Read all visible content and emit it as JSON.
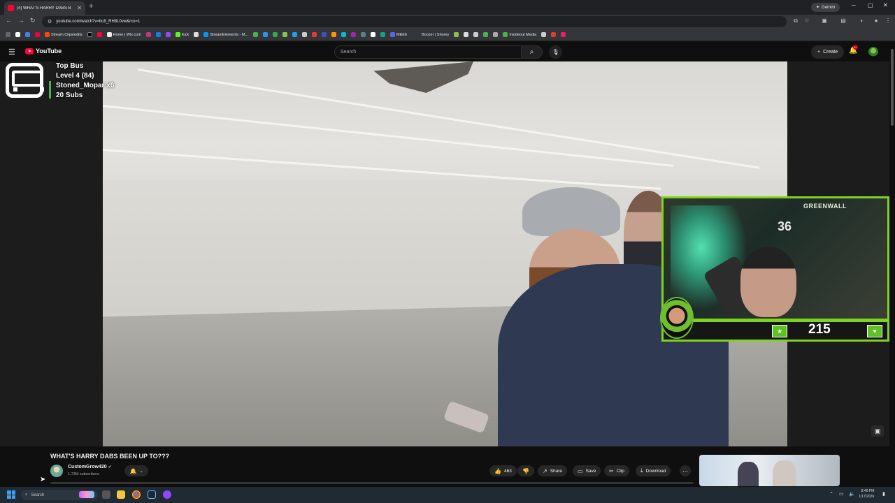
{
  "browser": {
    "tab_title": "(4) WHAT'S HARRY DABS B",
    "new_tab": "+",
    "gemini": "Gemini",
    "url": "youtube.com/watch?v=bu9_RH8L0vw&rco=1",
    "bookmarks": [
      "Stream Clips/edits",
      "Home | Wix.com",
      "Kick",
      "StreamElements - M...",
      "MEE6",
      "Boozer | Shorey",
      "Insideout Media"
    ]
  },
  "youtube": {
    "logo": "YouTube",
    "search_placeholder": "Search",
    "create": "Create",
    "notif_count": "9+"
  },
  "overlay": {
    "line1": "Top Bus",
    "line2": "Level 4  (84)",
    "line3": "Stoned_Mopar x6",
    "line4": "20 Subs"
  },
  "webcam": {
    "sign": "GREENWALL",
    "jersey": "36",
    "count": "215"
  },
  "video": {
    "title": "WHAT'S HARRY DABS BEEN UP TO???",
    "channel": "CustomGrow420",
    "subscribers": "1.73M subscribers",
    "likes": "463",
    "share": "Share",
    "save": "Save",
    "clip": "Clip",
    "download": "Download"
  },
  "taskbar": {
    "search": "Search",
    "time": "8:49 PM",
    "date": "1/17/2026"
  }
}
